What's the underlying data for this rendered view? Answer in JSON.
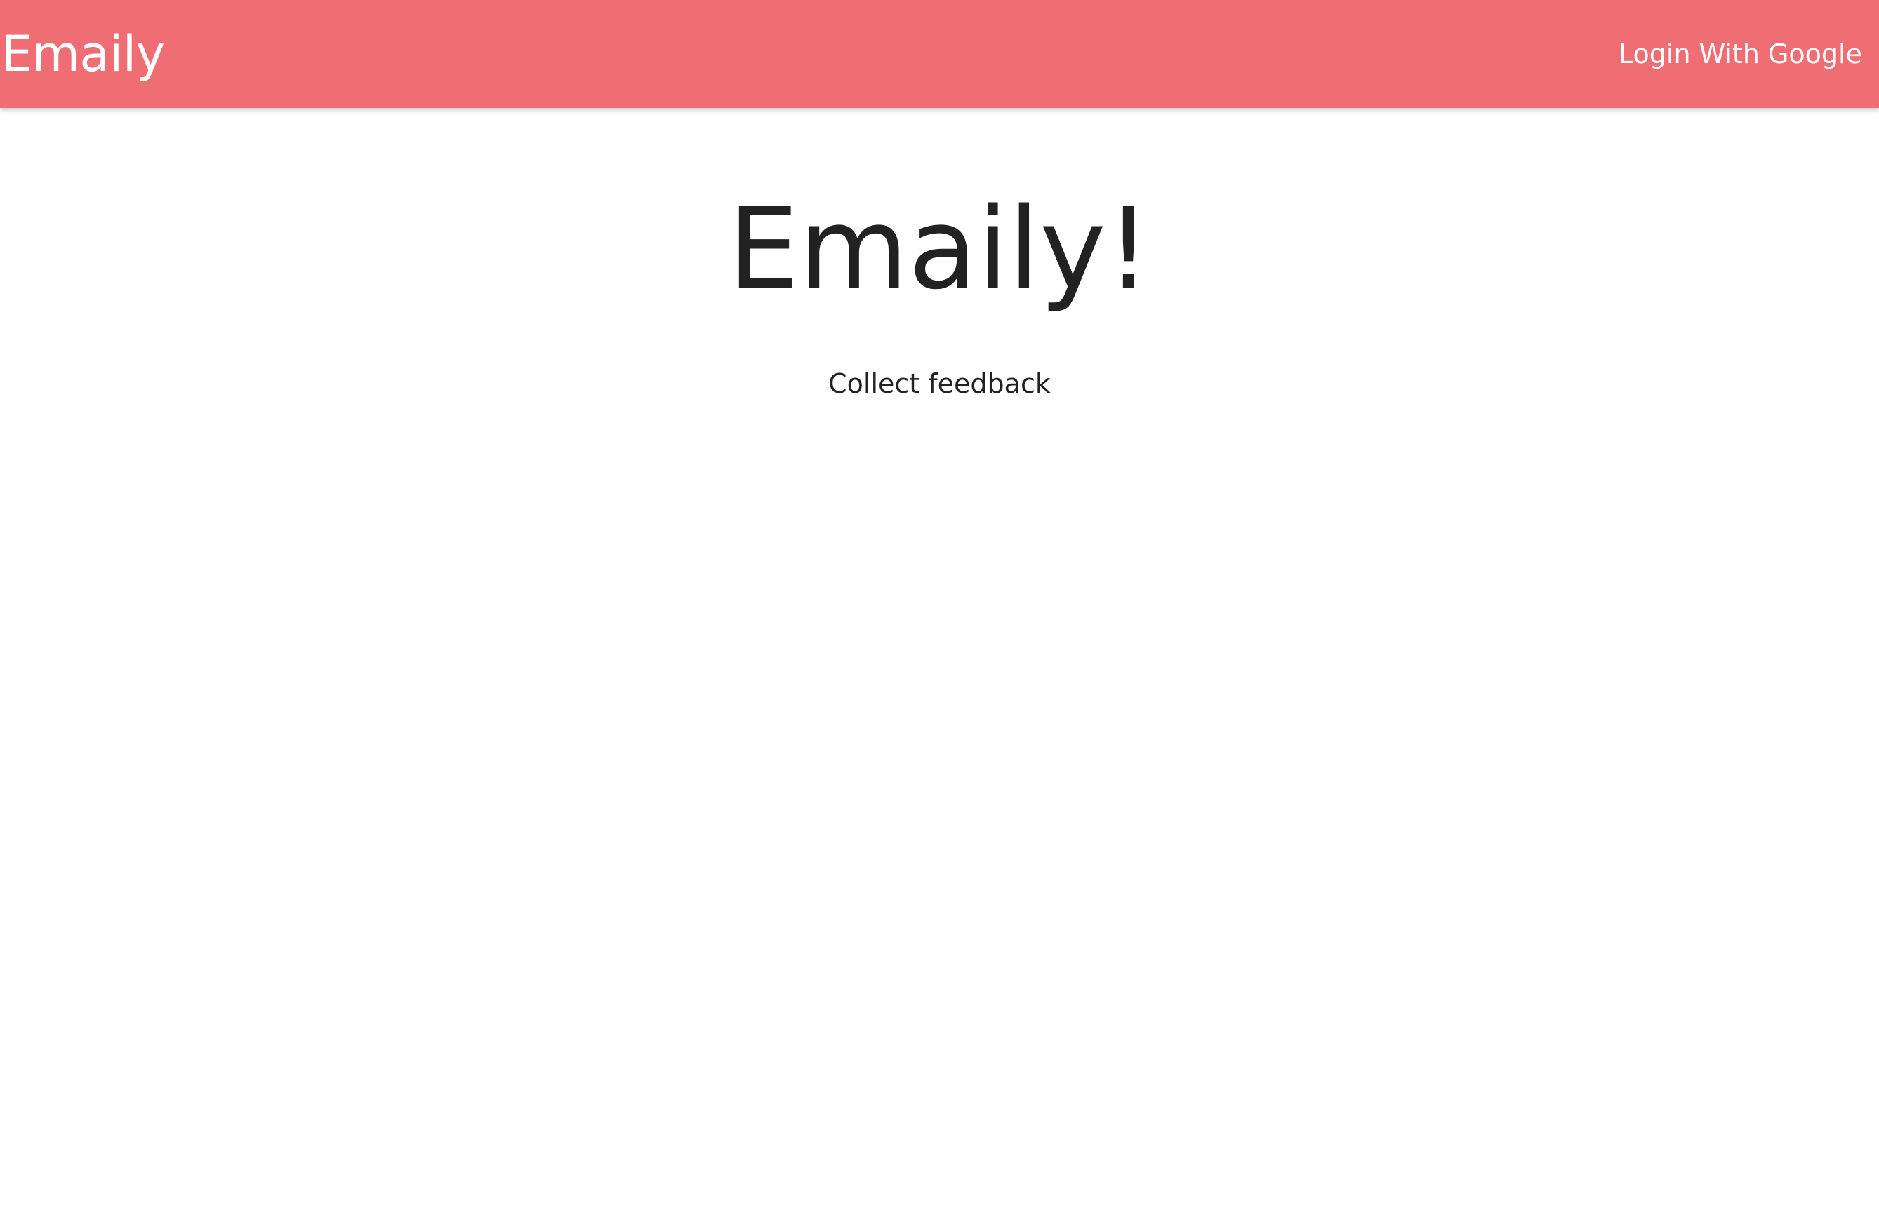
{
  "navbar": {
    "brand": "Emaily",
    "login_label": "Login With Google",
    "background_color": "#ef6e74"
  },
  "hero": {
    "title": "Emaily!",
    "subtitle": "Collect feedback"
  }
}
